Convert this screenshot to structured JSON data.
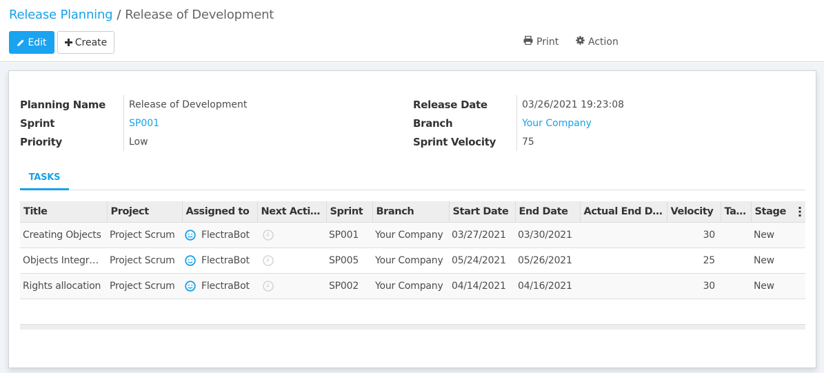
{
  "breadcrumb": {
    "parent": "Release Planning",
    "separator": "/",
    "current": "Release of Development"
  },
  "toolbar": {
    "edit_label": "Edit",
    "create_label": "Create",
    "print_label": "Print",
    "action_label": "Action"
  },
  "form": {
    "left": [
      {
        "label": "Planning Name",
        "value": "Release of Development",
        "link": false
      },
      {
        "label": "Sprint",
        "value": "SP001",
        "link": true
      },
      {
        "label": "Priority",
        "value": "Low",
        "link": false
      }
    ],
    "right": [
      {
        "label": "Release Date",
        "value": "03/26/2021 19:23:08",
        "link": false
      },
      {
        "label": "Branch",
        "value": "Your Company",
        "link": true
      },
      {
        "label": "Sprint Velocity",
        "value": "75",
        "link": false
      }
    ]
  },
  "tabs": [
    {
      "label": "TASKS",
      "active": true
    }
  ],
  "tasks": {
    "columns": [
      "Title",
      "Project",
      "Assigned to",
      "Next Activity",
      "Sprint",
      "Branch",
      "Start Date",
      "End Date",
      "Actual End Dat…",
      "Velocity",
      "Tags",
      "Stage"
    ],
    "rows": [
      {
        "title": "Creating Objects",
        "project": "Project Scrum",
        "assigned_to": "FlectraBot",
        "next_activity": "clock-icon",
        "sprint": "SP001",
        "branch": "Your Company",
        "start_date": "03/27/2021",
        "end_date": "03/30/2021",
        "actual_end_date": "",
        "velocity": "30",
        "tags": "",
        "stage": "New"
      },
      {
        "title": "Objects Integra…",
        "project": "Project Scrum",
        "assigned_to": "FlectraBot",
        "next_activity": "clock-icon",
        "sprint": "SP005",
        "branch": "Your Company",
        "start_date": "05/24/2021",
        "end_date": "05/26/2021",
        "actual_end_date": "",
        "velocity": "25",
        "tags": "",
        "stage": "New"
      },
      {
        "title": "Rights allocation",
        "project": "Project Scrum",
        "assigned_to": "FlectraBot",
        "next_activity": "clock-icon",
        "sprint": "SP002",
        "branch": "Your Company",
        "start_date": "04/14/2021",
        "end_date": "04/16/2021",
        "actual_end_date": "",
        "velocity": "30",
        "tags": "",
        "stage": "New"
      }
    ]
  },
  "colors": {
    "primary": "#1aa3ef",
    "link": "#17a2e8"
  }
}
